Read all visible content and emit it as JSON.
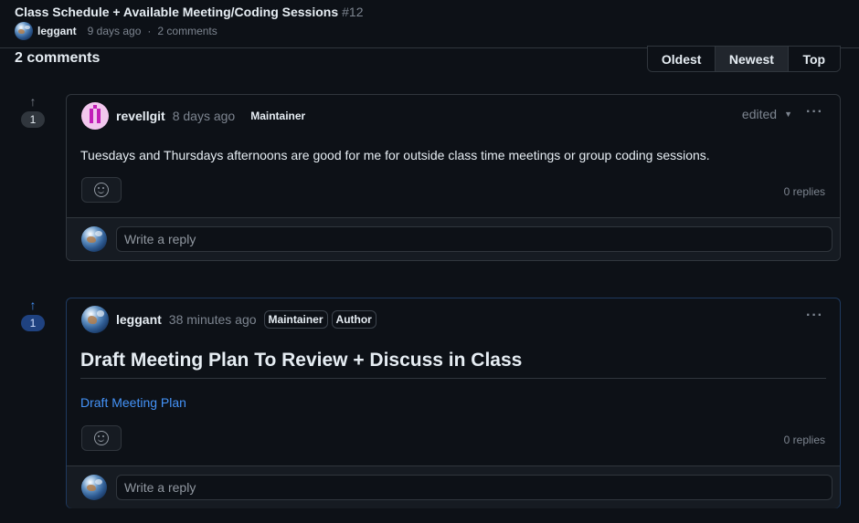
{
  "header": {
    "title": "Class Schedule + Available Meeting/Coding Sessions",
    "number": "#12",
    "author": "leggant",
    "time": "9 days ago",
    "comments_count": "2 comments"
  },
  "comments_section": {
    "title": "2 comments",
    "sort_options": [
      "Oldest",
      "Newest",
      "Top"
    ],
    "active_sort": "Newest"
  },
  "comments": [
    {
      "votes": "1",
      "upvoted": false,
      "author": "revellgit",
      "time": "8 days ago",
      "badges": [
        "Maintainer"
      ],
      "edited_label": "edited",
      "body": "Tuesdays and Thursdays afternoons are good for me for outside class time meetings or group coding sessions.",
      "replies": "0 replies",
      "reply_placeholder": "Write a reply"
    },
    {
      "votes": "1",
      "upvoted": true,
      "author": "leggant",
      "time": "38 minutes ago",
      "badges": [
        "Maintainer",
        "Author"
      ],
      "heading": "Draft Meeting Plan To Review + Discuss in Class",
      "link_text": "Draft Meeting Plan",
      "replies": "0 replies",
      "reply_placeholder": "Write a reply"
    }
  ],
  "icons": {
    "upvote": "arrow-up-icon",
    "react": "smiley-icon",
    "more": "kebab-horizontal-icon",
    "edited_menu": "triangle-down-icon"
  },
  "colors": {
    "background": "#0d1117",
    "border": "#30363d",
    "text": "#e6edf3",
    "muted": "#7d8590",
    "link": "#4493f8",
    "highlight_pill": "#1f4280"
  }
}
